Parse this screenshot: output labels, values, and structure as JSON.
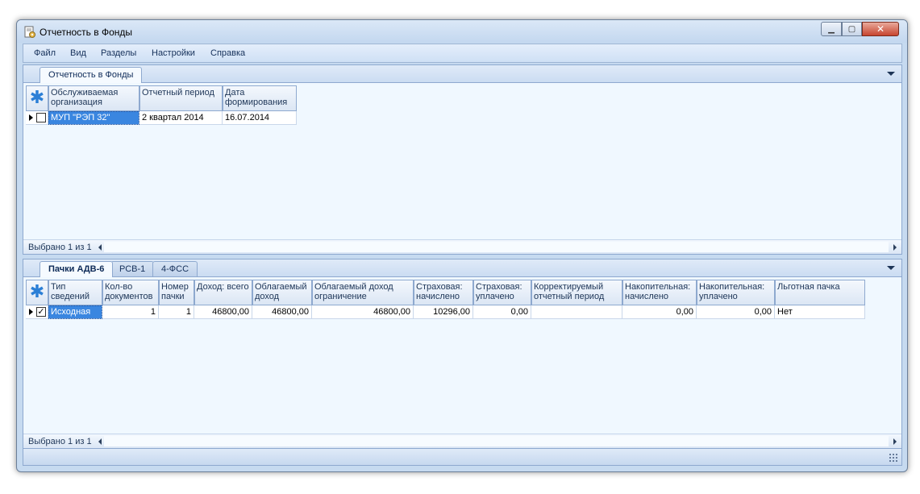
{
  "window": {
    "title": "Отчетность в Фонды",
    "app_icon": "report-gear-icon",
    "controls": {
      "minimize": "minimize-icon",
      "maximize": "maximize-icon",
      "close": "close-icon"
    }
  },
  "menu": {
    "items": [
      "Файл",
      "Вид",
      "Разделы",
      "Настройки",
      "Справка"
    ]
  },
  "top_section": {
    "tabs": [
      {
        "label": "Отчетность в Фонды",
        "active": true
      }
    ],
    "grid": {
      "add_icon": "✱",
      "columns": [
        "Обслуживаемая организация",
        "Отчетный период",
        "Дата формирования"
      ],
      "rows": [
        {
          "checked": false,
          "cells": [
            "МУП \"РЭП 32\"",
            "2 квартал 2014",
            "16.07.2014"
          ]
        }
      ]
    },
    "status": "Выбрано 1 из 1"
  },
  "bottom_section": {
    "tabs": [
      {
        "label": "Пачки АДВ-6",
        "active": true
      },
      {
        "label": "РСВ-1",
        "active": false
      },
      {
        "label": "4-ФСС",
        "active": false
      }
    ],
    "grid": {
      "add_icon": "✱",
      "columns": [
        "Тип сведений",
        "Кол-во документов",
        "Номер пачки",
        "Доход: всего",
        "Облагаемый доход",
        "Облагаемый доход ограничение",
        "Страховая: начислено",
        "Страховая: уплачено",
        "Корректируемый отчетный период",
        "Накопительная: начислено",
        "Накопительная: уплачено",
        "Льготная пачка"
      ],
      "rows": [
        {
          "checked": true,
          "cells": [
            "Исходная",
            "1",
            "1",
            "46800,00",
            "46800,00",
            "46800,00",
            "10296,00",
            "0,00",
            "",
            "0,00",
            "0,00",
            "Нет"
          ]
        }
      ]
    },
    "status": "Выбрано 1 из 1"
  }
}
